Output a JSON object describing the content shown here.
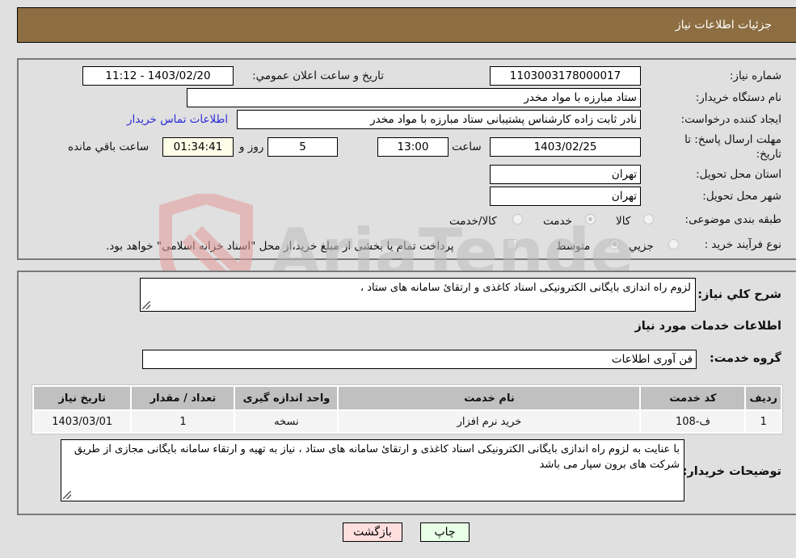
{
  "header": {
    "title": "جزئیات اطلاعات نیاز"
  },
  "fields": {
    "need_number": {
      "label": "شماره نیاز:",
      "value": "1103003178000017"
    },
    "announce_datetime": {
      "label": "تاریخ و ساعت اعلان عمومي:",
      "value": "1403/02/20 - 11:12"
    },
    "buyer_org": {
      "label": "نام دستگاه خریدار:",
      "value": "ستاد مبارزه با مواد مخدر"
    },
    "requester": {
      "label": "ایجاد کننده درخواست:",
      "value": "نادر ثابت زاده کارشناس پشتیبانی ستاد مبارزه با مواد مخدر"
    },
    "buyer_contact_link": "اطلاعات تماس خریدار",
    "deadline": {
      "label_line1": "مهلت ارسال پاسخ: تا",
      "label_line2": "تاریخ:",
      "date": "1403/02/25",
      "time_label": "ساعت",
      "time": "13:00",
      "days": "5",
      "days_label": "روز و",
      "remaining": "01:34:41",
      "remaining_label": "ساعت باقي مانده"
    },
    "province": {
      "label": "استان محل تحویل:",
      "value": "تهران"
    },
    "city": {
      "label": "شهر محل تحویل:",
      "value": "تهران"
    },
    "category": {
      "label": "طبقه بندی موضوعی:",
      "options": [
        {
          "label": "کالا",
          "checked": false
        },
        {
          "label": "خدمت",
          "checked": true
        },
        {
          "label": "کالا/خدمت",
          "checked": false
        }
      ]
    },
    "process_type": {
      "label": "نوع فرآیند خرید :",
      "options": [
        {
          "label": "جزيي",
          "checked": false
        },
        {
          "label": "متوسط",
          "checked": true
        }
      ],
      "treasury_checkbox_label": "پرداخت تمام یا بخشی از مبلغ خرید،از محل \"اسناد خزانه اسلامی\" خواهد بود.",
      "treasury_checked": false
    }
  },
  "general_description": {
    "label": "شرح کلي نیاز:",
    "value": "لزوم راه اندازی بایگانی الکترونیکی اسناد کاغذی و ارتقائ سامانه های ستاد ،"
  },
  "services_section": {
    "title": "اطلاعات خدمات مورد نیاز",
    "service_group": {
      "label": "گروه خدمت:",
      "value": "فن آوری اطلاعات"
    },
    "table": {
      "headers": [
        "ردیف",
        "کد خدمت",
        "نام خدمت",
        "واحد اندازه گیری",
        "تعداد / مقدار",
        "تاریخ نیاز"
      ],
      "rows": [
        [
          "1",
          "ف-108",
          "خرید نرم افزار",
          "نسخه",
          "1",
          "1403/03/01"
        ]
      ]
    }
  },
  "buyer_notes": {
    "label": "توضیحات خریدار:",
    "value": "با عنایت به لزوم راه اندازی بایگانی الکترونیکی اسناد کاغذی و ارتقائ سامانه های ستاد ، نیاز به تهیه و ارتقاء سامانه بایگانی مجازی از طریق شرکت های برون سپار می باشد"
  },
  "buttons": {
    "print": "چاپ",
    "back": "بازگشت"
  },
  "watermark": {
    "text": "AriaTender.neT"
  }
}
